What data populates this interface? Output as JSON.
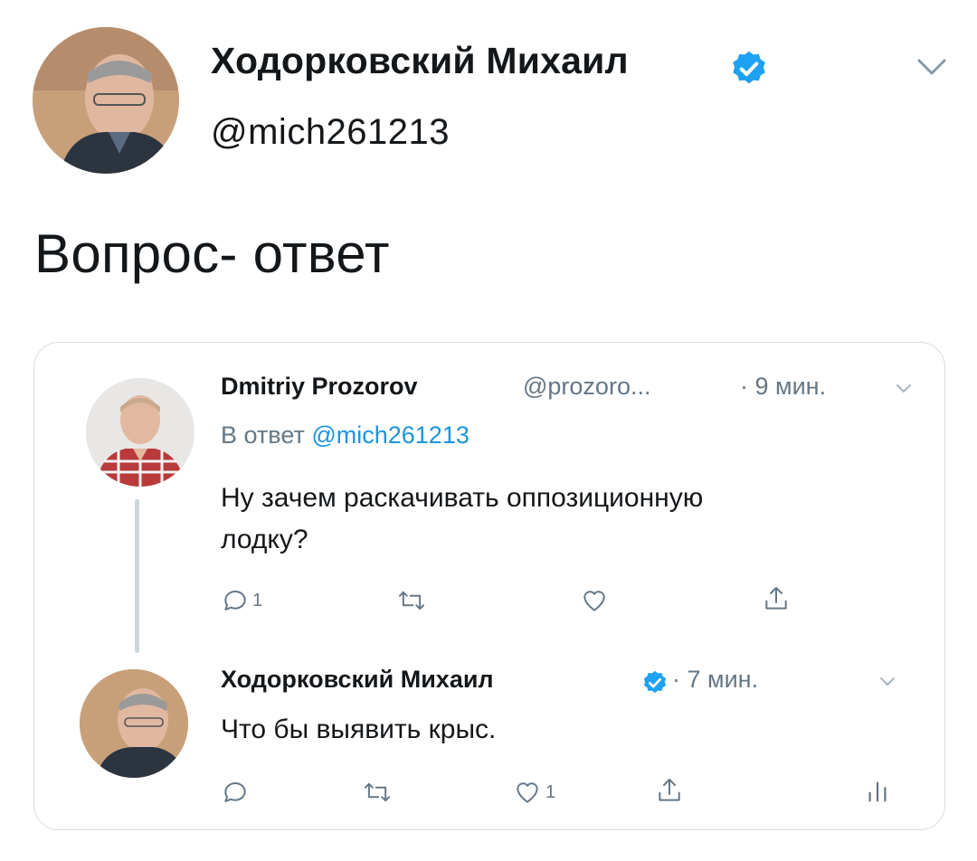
{
  "main_tweet": {
    "author_name": "Ходорковский Михаил",
    "author_handle": "@mich261213",
    "text": "Вопрос- ответ"
  },
  "thread": {
    "reply": {
      "author_name": "Dmitriy Prozorov",
      "author_handle": "@prozoro...",
      "time": "· 9 мин.",
      "reply_to_prefix": "В ответ",
      "reply_to_handle": "@mich261213",
      "text_line1": "Ну зачем раскачивать оппозиционную",
      "text_line2": "лодку?",
      "actions": {
        "reply_count": "1",
        "retweet_count": "",
        "like_count": "",
        "share": ""
      }
    },
    "answer": {
      "author_name": "Ходорковский Михаил",
      "time": "· 7 мин.",
      "text": "Что бы выявить крыс.",
      "actions": {
        "reply_count": "",
        "retweet_count": "",
        "like_count": "1",
        "share": "",
        "analytics": ""
      }
    }
  },
  "icons": [
    "verified-badge-icon",
    "chevron-down-icon",
    "reply-icon",
    "retweet-icon",
    "like-icon",
    "share-icon",
    "analytics-icon"
  ],
  "colors": {
    "accent": "#1da1f2",
    "link": "#1b95e0",
    "muted": "#657786",
    "border": "#d6dde3"
  }
}
